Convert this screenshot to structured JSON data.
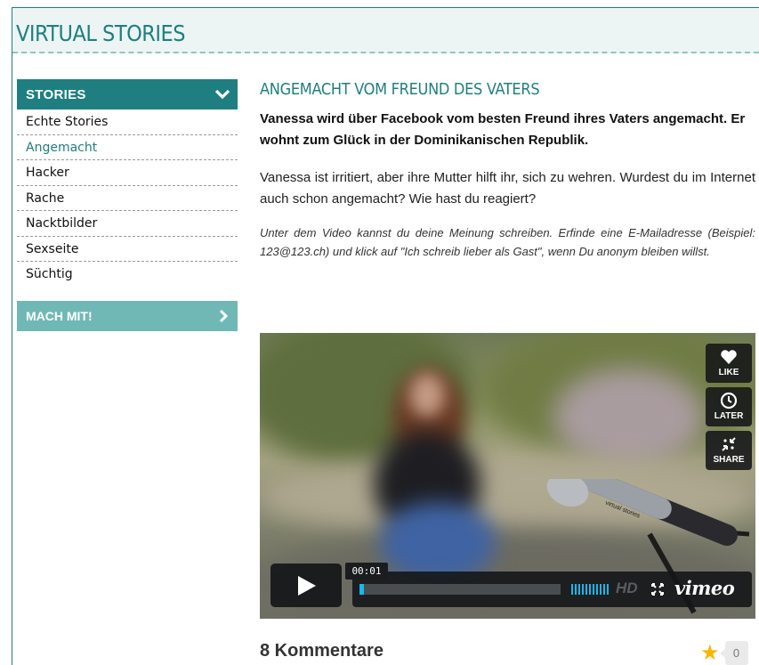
{
  "header": {
    "site_title": "VIRTUAL STORIES"
  },
  "sidebar": {
    "section_label": "STORIES",
    "items": [
      {
        "label": "Echte Stories"
      },
      {
        "label": "Angemacht"
      },
      {
        "label": "Hacker"
      },
      {
        "label": "Rache"
      },
      {
        "label": "Nacktbilder"
      },
      {
        "label": "Sexseite"
      },
      {
        "label": "Süchtig"
      }
    ],
    "active_item": "Angemacht",
    "cta_label": "MACH MIT!"
  },
  "article": {
    "title": "ANGEMACHT VOM FREUND DES VATERS",
    "lead": "Vanessa wird über Facebook vom besten Freund ihres Vaters angemacht. Er wohnt zum Glück in der Dominikanischen Republik.",
    "body": "Vanessa ist irritiert, aber ihre Mutter hilft ihr, sich zu wehren. Wurdest du im Internet auch schon angemacht? Wie hast du reagiert?",
    "hint": "Unter dem Video kannst du deine Meinung schreiben. Erfinde eine E-Mailadresse (Beispiel: 123@123.ch) und klick auf \"Ich schreib lieber als Gast\", wenn Du anonym bleiben willst."
  },
  "video": {
    "like_label": "LIKE",
    "later_label": "LATER",
    "share_label": "SHARE",
    "time": "00:01",
    "progress": 0.01,
    "hd_label": "HD",
    "brand": "vimeo",
    "mic_text": "virtual stories",
    "icons": [
      "heart-icon",
      "clock-icon",
      "share-icon",
      "play-icon",
      "fullscreen-icon"
    ]
  },
  "comments": {
    "label": "8 Kommentare",
    "rating_count": "0"
  },
  "colors": {
    "brand": "#1f7f80",
    "brand_light": "#70b8b5",
    "header_bg": "#ecf5f4",
    "star": "#f5b800",
    "player_accent": "#1ab7ea"
  }
}
